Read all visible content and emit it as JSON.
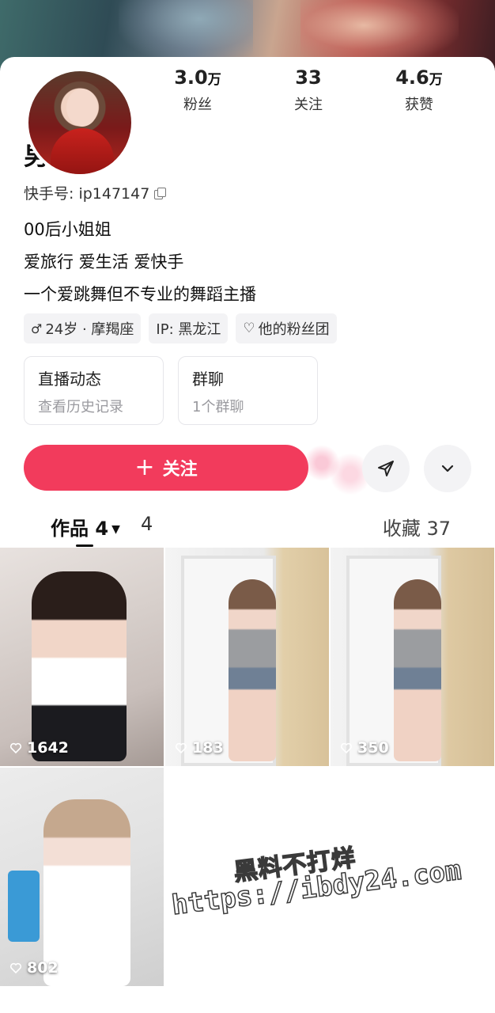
{
  "profile": {
    "name": "男王",
    "kuaishou_id": "快手号: ip147147",
    "bio": [
      "00后小姐姐",
      "爱旅行 爱生活 爱快手",
      "一个爱跳舞但不专业的舞蹈主播"
    ]
  },
  "stats": [
    {
      "number": "3.0",
      "unit": "万",
      "label": "粉丝"
    },
    {
      "number": "33",
      "unit": "",
      "label": "关注"
    },
    {
      "number": "4.6",
      "unit": "万",
      "label": "获赞"
    }
  ],
  "tags": [
    {
      "icon": "male-icon",
      "text": "24岁 · 摩羯座"
    },
    {
      "icon": "",
      "text": "IP: 黑龙江"
    },
    {
      "icon": "heart-outline-icon",
      "text": "他的粉丝团"
    }
  ],
  "quick_cards": [
    {
      "title": "直播动态",
      "subtitle": "查看历史记录"
    },
    {
      "title": "群聊",
      "subtitle": "1个群聊"
    }
  ],
  "actions": {
    "follow_label": "关注"
  },
  "tabs": {
    "works": "作品 4",
    "ghost": "4",
    "favorites": "收藏 37"
  },
  "videos": [
    {
      "likes": "1642"
    },
    {
      "likes": "183"
    },
    {
      "likes": "350"
    },
    {
      "likes": "802"
    }
  ],
  "watermark": {
    "line1": "黑料不打烊",
    "line2": "https://ibdy24.com"
  },
  "colors": {
    "follow": "#f23b5c",
    "tag_bg": "#f3f3f5"
  }
}
